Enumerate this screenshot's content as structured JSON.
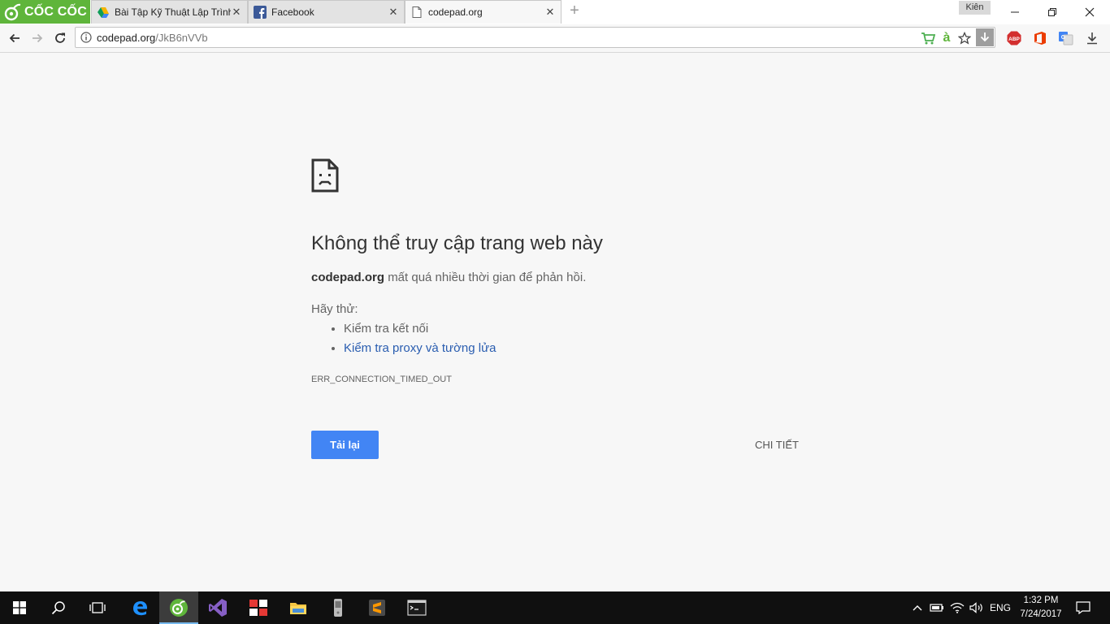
{
  "browser": {
    "name": "CỐC CỐC",
    "tabs": [
      {
        "title": "Bài Tập Kỹ Thuật Lập Trình",
        "icon": "google-drive-icon"
      },
      {
        "title": "Facebook",
        "icon": "facebook-icon"
      },
      {
        "title": "codepad.org",
        "icon": "page-icon",
        "active": true
      }
    ],
    "profile_name": "Kiên",
    "url_host": "codepad.org",
    "url_path": "/JkB6nVVb",
    "accent_color": "#5fb53b"
  },
  "error_page": {
    "title": "Không thể truy cập trang web này",
    "host": "codepad.org",
    "message": "mất quá nhiều thời gian để phản hồi.",
    "try_label": "Hãy thử:",
    "suggestions": [
      "Kiểm tra kết nối",
      "Kiểm tra proxy và tường lửa"
    ],
    "error_code": "ERR_CONNECTION_TIMED_OUT",
    "reload_label": "Tải lại",
    "details_label": "CHI TIẾT",
    "button_color": "#4285f4"
  },
  "taskbar": {
    "language": "ENG",
    "time": "1:32 PM",
    "date": "7/24/2017"
  }
}
